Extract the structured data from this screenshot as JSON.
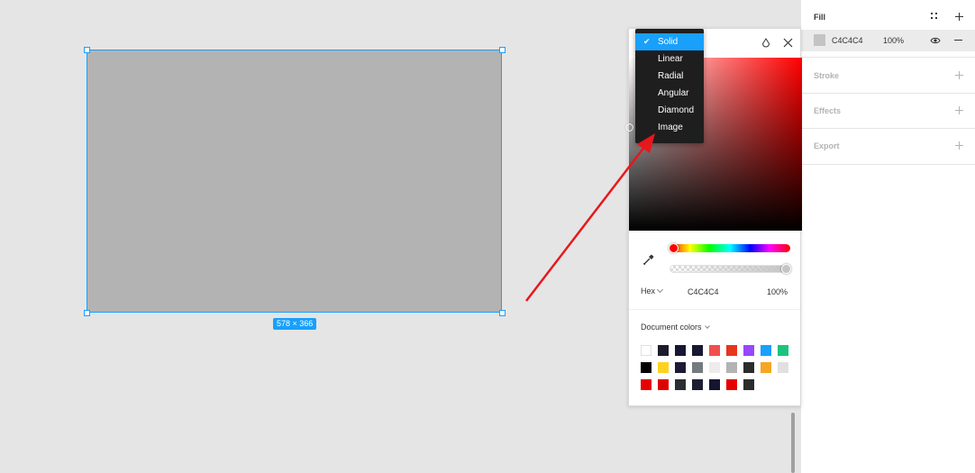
{
  "canvas": {
    "dimension_label": "578 × 366"
  },
  "fill_dropdown": {
    "options": [
      {
        "label": "Solid",
        "selected": true
      },
      {
        "label": "Linear",
        "selected": false
      },
      {
        "label": "Radial",
        "selected": false
      },
      {
        "label": "Angular",
        "selected": false
      },
      {
        "label": "Diamond",
        "selected": false
      },
      {
        "label": "Image",
        "selected": false
      }
    ]
  },
  "picker": {
    "mode": "Hex",
    "hex": "C4C4C4",
    "opacity": "100%",
    "document_colors_label": "Document colors",
    "swatches": [
      [
        "#ffffff",
        "#1c1c2b",
        "#171733",
        "#181833",
        "#f24e4e",
        "#e8351e",
        "#9747ff",
        "#18a0fb",
        "#1bc47d"
      ],
      [
        "#000000",
        "#ffd21f",
        "#1b1b38",
        "#737a80",
        "#ececec",
        "#b3b3b3",
        "#2c2c2c",
        "#f5a623",
        "#e0e0e0"
      ],
      [
        "#e60000",
        "#e00000",
        "#2a2d33",
        "#1e1e33",
        "#151530",
        "#e60000",
        "#2b2b2b"
      ]
    ]
  },
  "props": {
    "fill": {
      "title": "Fill",
      "hex": "C4C4C4",
      "opacity": "100%"
    },
    "stroke": {
      "title": "Stroke"
    },
    "effects": {
      "title": "Effects"
    },
    "export": {
      "title": "Export"
    }
  },
  "colors": {
    "accent": "#18a0fb",
    "arrow": "#e8171b",
    "shape_fill": "#b3b3b3"
  }
}
